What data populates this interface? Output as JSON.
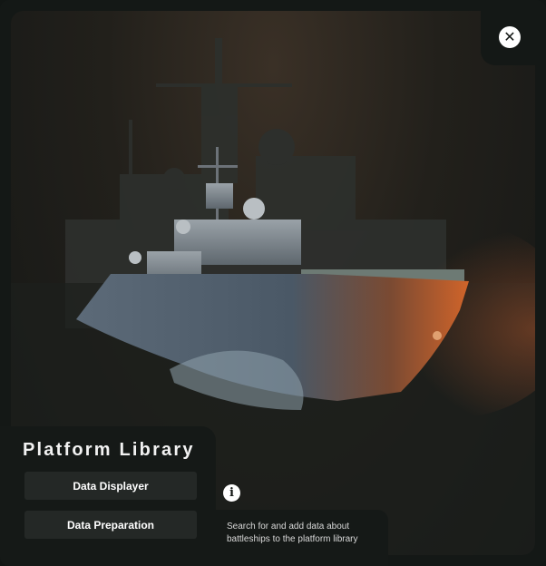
{
  "panel": {
    "title": "Platform Library",
    "buttons": [
      "Data Displayer",
      "Data Preparation"
    ]
  },
  "info": {
    "description": "Search for and add data about battleships to the platform library"
  },
  "icons": {
    "close": "close-icon",
    "info": "info-icon"
  },
  "colors": {
    "background": "#141816",
    "button": "#242826",
    "text": "#ffffff",
    "hull_accent": "#c25a24"
  }
}
